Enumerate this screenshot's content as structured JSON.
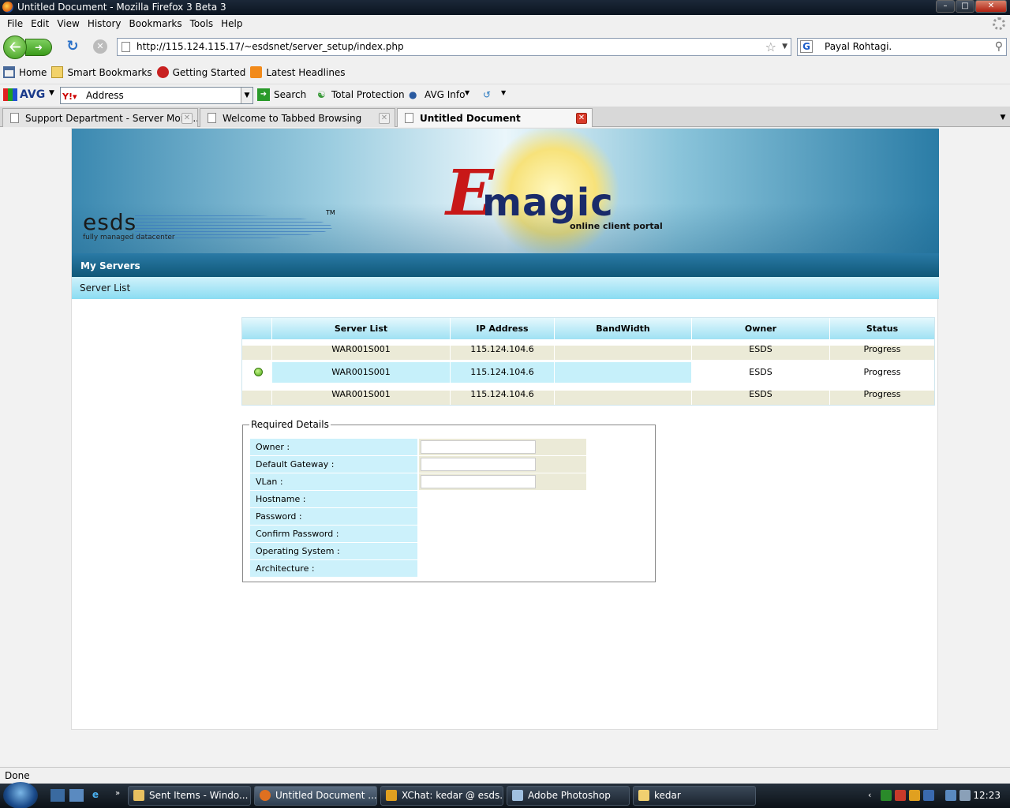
{
  "window": {
    "title": "Untitled Document - Mozilla Firefox 3 Beta 3"
  },
  "menu": [
    "File",
    "Edit",
    "View",
    "History",
    "Bookmarks",
    "Tools",
    "Help"
  ],
  "nav": {
    "url": "http://115.124.115.17/~esdsnet/server_setup/index.php",
    "search_text": "Payal Rohtagi."
  },
  "bookmarks": [
    "Home",
    "Smart Bookmarks",
    "Getting Started",
    "Latest Headlines"
  ],
  "avg": {
    "logo": "AVG",
    "address_label": "Address",
    "search": "Search",
    "total_protection": "Total Protection",
    "avg_info": "AVG Info"
  },
  "tabs": [
    {
      "label": "Support Department - Server Monit...",
      "active": false
    },
    {
      "label": "Welcome to Tabbed Browsing",
      "active": false
    },
    {
      "label": "Untitled Document",
      "active": true
    }
  ],
  "banner": {
    "esds": "esds",
    "esds_tagline": "fully managed datacenter",
    "tm": "TM",
    "emagic_e": "E",
    "emagic": "magic",
    "portal": "online client portal"
  },
  "section": {
    "title": "My Servers",
    "subtitle": "Server List"
  },
  "table": {
    "headers": [
      "",
      "Server List",
      "IP Address",
      "BandWidth",
      "Owner",
      "Status"
    ],
    "rows": [
      {
        "server": "WAR001S001",
        "ip": "115.124.104.6",
        "bandwidth": "",
        "owner": "ESDS",
        "status": "Progress"
      },
      {
        "server": "WAR001S001",
        "ip": "115.124.104.6",
        "bandwidth": "",
        "owner": "ESDS",
        "status": "Progress"
      },
      {
        "server": "WAR001S001",
        "ip": "115.124.104.6",
        "bandwidth": "",
        "owner": "ESDS",
        "status": "Progress"
      }
    ]
  },
  "form": {
    "legend": "Required Details",
    "fields": [
      "Owner :",
      "Default Gateway :",
      "VLan :",
      "Hostname :",
      "Password :",
      "Confirm Password :",
      "Operating System :",
      "Architecture :"
    ]
  },
  "status": "Done",
  "taskbar": {
    "items": [
      "Sent Items - Windo...",
      "Untitled Document ...",
      "XChat: kedar @ esds...",
      "Adobe Photoshop",
      "kedar"
    ],
    "clock": "12:23"
  }
}
